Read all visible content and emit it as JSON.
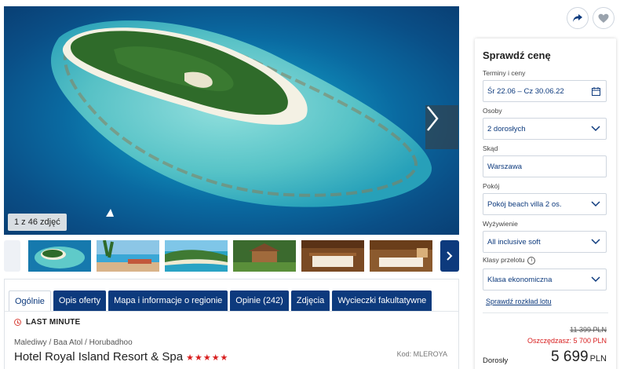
{
  "gallery": {
    "counter": "1 z 46 zdjęć",
    "thumbnails": [
      "island-aerial",
      "pool-terrace",
      "island-beach",
      "villa-garden",
      "bedroom-wood",
      "bedroom-villa"
    ]
  },
  "tabs": [
    {
      "label": "Ogólnie",
      "active": true
    },
    {
      "label": "Opis oferty",
      "active": false
    },
    {
      "label": "Mapa i informacje o regionie",
      "active": false
    },
    {
      "label": "Opinie (242)",
      "active": false
    },
    {
      "label": "Zdjęcia",
      "active": false
    },
    {
      "label": "Wycieczki fakultatywne",
      "active": false
    }
  ],
  "offer": {
    "badge": "LAST MINUTE",
    "breadcrumb": "Malediwy / Baa Atol / Horubadhoo",
    "hotel_name": "Hotel Royal Island Resort & Spa",
    "stars": "★★★★★",
    "code": "Kod: MLEROYA"
  },
  "price_panel": {
    "title": "Sprawdź cenę",
    "dates_label": "Terminy i ceny",
    "dates_value": "Śr 22.06 – Cz 30.06.22",
    "persons_label": "Osoby",
    "persons_value": "2 dorosłych",
    "from_label": "Skąd",
    "from_value": "Warszawa",
    "room_label": "Pokój",
    "room_value": "Pokój beach villa 2 os.",
    "board_label": "Wyżywienie",
    "board_value": "All inclusive soft",
    "flight_class_label": "Klasy przelotu",
    "flight_class_value": "Klasa ekonomiczna",
    "schedule_link": "Sprawdź rozkład lotu",
    "old_price": "11 399 PLN",
    "saving": "Oszczędzasz: 5 700 PLN",
    "adults_label": "Dorosły",
    "final_price": "5 699",
    "currency": "PLN"
  },
  "colors": {
    "brand": "#0d3a7d",
    "stars": "#d81e1e",
    "saving": "#d81e1e"
  },
  "icons": [
    "share-icon",
    "heart-icon",
    "chevron-right-icon",
    "calendar-icon",
    "chevron-down-icon",
    "info-icon",
    "clock-icon"
  ]
}
